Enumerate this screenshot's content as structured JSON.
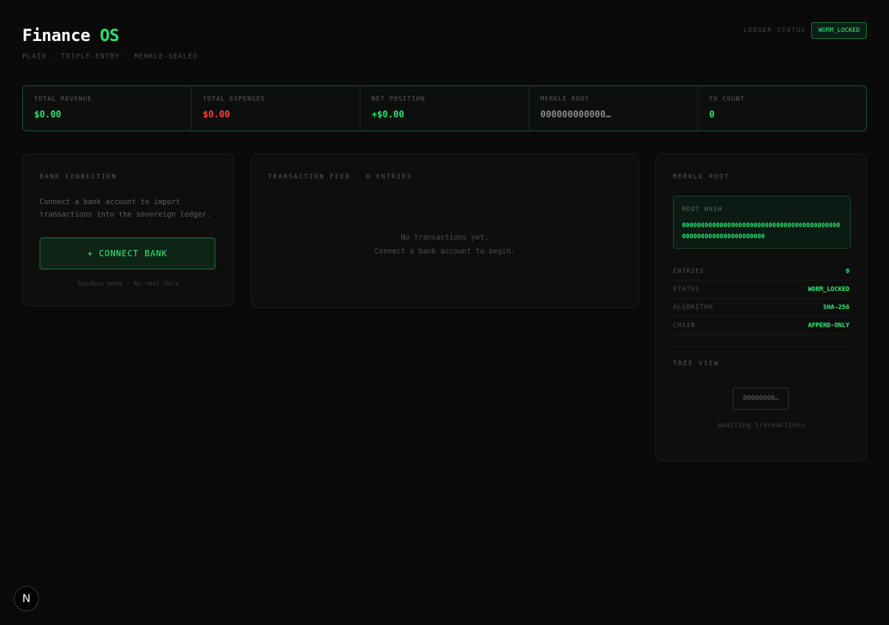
{
  "header": {
    "title_main": "Finance",
    "title_accent": "OS",
    "subtitle": "PLAID · TRIPLE-ENTRY · MERKLE-SEALED",
    "ledger_status_label": "LEDGER STATUS",
    "ledger_status_value": "WORM_LOCKED"
  },
  "stats": [
    {
      "label": "TOTAL REVENUE",
      "value": "$0.00",
      "color": "#22e36f"
    },
    {
      "label": "TOTAL EXPENSES",
      "value": "$0.00",
      "color": "#ff3d3d"
    },
    {
      "label": "NET POSITION",
      "value": "+$0.00",
      "color": "#22e36f"
    },
    {
      "label": "MERKLE ROOT",
      "value": "000000000000…",
      "color": "#8a8a8a"
    },
    {
      "label": "TX COUNT",
      "value": "0",
      "color": "#22e36f"
    }
  ],
  "bank": {
    "title": "BANK CONNECTION",
    "description": "Connect a bank account to import transactions into the sovereign ledger.",
    "button_label": "+ CONNECT BANK",
    "note": "Sandbox mode · No real data"
  },
  "feed": {
    "title": "TRANSACTION FEED · 0 ENTRIES",
    "empty_line1": "No transactions yet.",
    "empty_line2": "Connect a bank account to begin."
  },
  "merkle": {
    "title": "MERKLE ROOT",
    "hash_label": "ROOT HASH",
    "hash_value": "0000000000000000000000000000000000000000000000000000000000000000",
    "rows": [
      {
        "key": "ENTRIES",
        "value": "0"
      },
      {
        "key": "STATUS",
        "value": "WORM_LOCKED"
      },
      {
        "key": "ALGORITHM",
        "value": "SHA-256"
      },
      {
        "key": "CHAIN",
        "value": "APPEND-ONLY"
      }
    ],
    "tree_title": "TREE VIEW",
    "tree_node": "00000000…",
    "tree_empty": "awaiting transactions"
  },
  "brand": {
    "logo_letter": "N"
  },
  "colors": {
    "accent": "#22e36f",
    "negative": "#ff3d3d",
    "background": "#0a0a0a"
  }
}
